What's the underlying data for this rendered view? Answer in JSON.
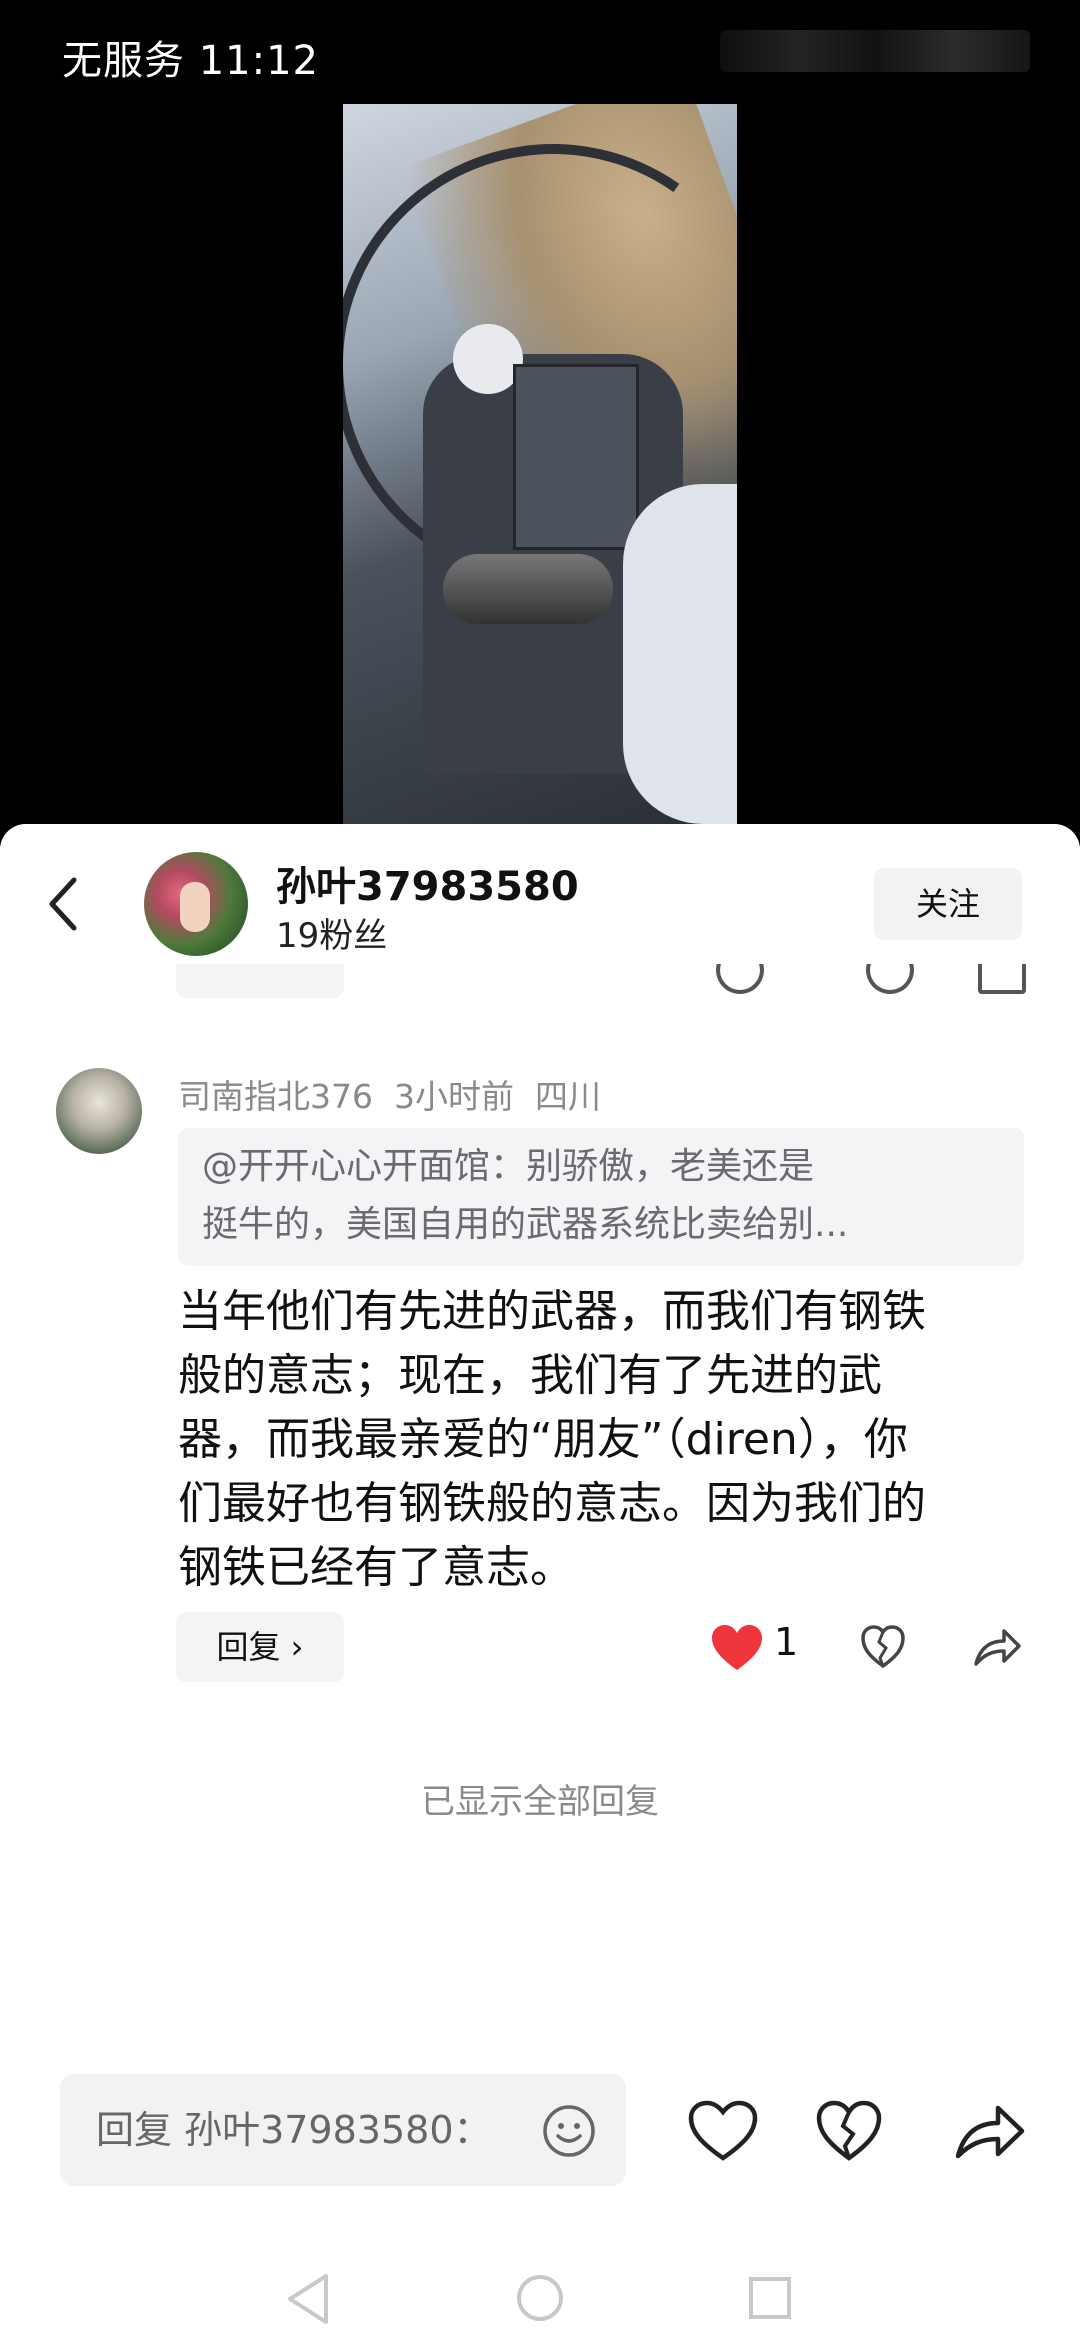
{
  "status_bar": {
    "carrier_time": "无服务 11:12"
  },
  "header": {
    "user_name": "孙叶37983580",
    "followers": "19粉丝",
    "follow_label": "关注"
  },
  "comment": {
    "meta": "司南指北376  3小时前  四川",
    "quote_lines": [
      "@开开心心开面馆：别骄傲，老美还是",
      "挺牛的，美国自用的武器系统比卖给别..."
    ],
    "text_lines": [
      "当年他们有先进的武器，而我们有钢铁",
      "般的意志；现在，我们有了先进的武",
      "器，而我最亲爱的“朋友”（diren），你",
      "们最好也有钢铁般的意志。因为我们的",
      "钢铁已经有了意志。"
    ],
    "reply_label": "回复 ›",
    "like_count": "1"
  },
  "footer_note": "已显示全部回复",
  "input": {
    "placeholder": "回复 孙叶37983580："
  },
  "colors": {
    "like_red": "#f0343c",
    "sheet_bg": "#ffffff",
    "muted_text": "#8a8a8e"
  },
  "icons": [
    "back-icon",
    "heart-icon",
    "broken-heart-icon",
    "share-icon",
    "emoji-icon",
    "nav-back-icon",
    "nav-home-icon",
    "nav-recent-icon"
  ]
}
